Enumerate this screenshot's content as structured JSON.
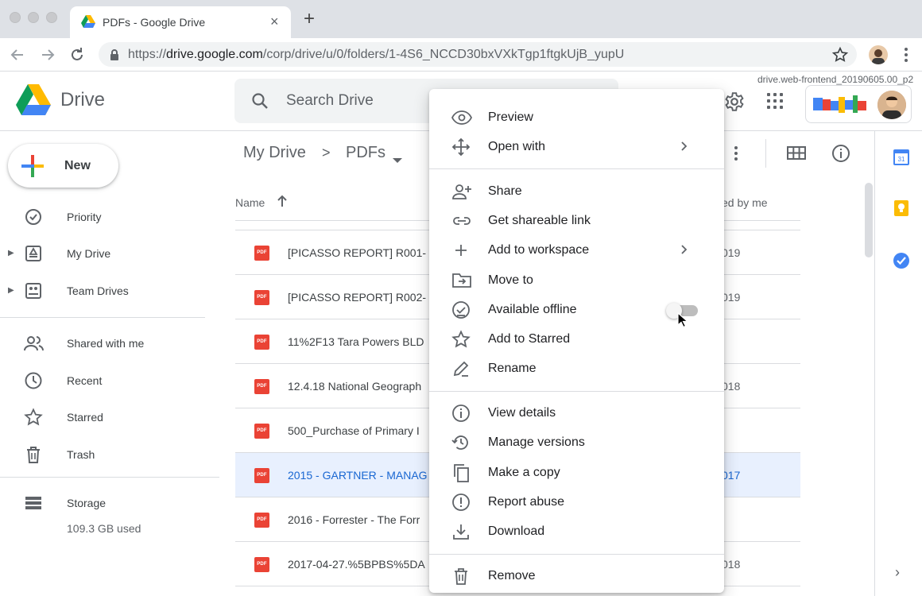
{
  "browser": {
    "tab_title": "PDFs - Google Drive",
    "tab_close": "×",
    "new_tab": "+",
    "url_prefix": "https://",
    "url_host": "drive.google.com",
    "url_path": "/corp/drive/u/0/folders/1-4S6_NCCD30bxVXkTgp1ftgkUjB_yupU"
  },
  "header": {
    "app_title": "Drive",
    "search_placeholder": "Search Drive",
    "version_label": "drive.web-frontend_20190605.00_p2"
  },
  "sidebar": {
    "new_label": "New",
    "items": [
      {
        "label": "Priority",
        "icon": "priority-icon"
      },
      {
        "label": "My Drive",
        "icon": "my-drive-icon"
      },
      {
        "label": "Team Drives",
        "icon": "team-drives-icon"
      },
      {
        "label": "Shared with me",
        "icon": "shared-with-me-icon"
      },
      {
        "label": "Recent",
        "icon": "clock-icon"
      },
      {
        "label": "Starred",
        "icon": "star-icon"
      },
      {
        "label": "Trash",
        "icon": "trash-icon"
      }
    ],
    "storage_label": "Storage",
    "storage_used": "109.3 GB used"
  },
  "main": {
    "breadcrumb_root": "My Drive",
    "breadcrumb_sep": ">",
    "breadcrumb_current": "PDFs",
    "col_name": "Name",
    "col_modified": "ed by me",
    "files": [
      {
        "name": "[PICASSO REPORT] R001-",
        "date": "019",
        "icon_text": "PDF"
      },
      {
        "name": "[PICASSO REPORT] R002-",
        "date": "019",
        "icon_text": "PDF"
      },
      {
        "name": "11%2F13 Tara Powers BLD",
        "date": "",
        "icon_text": "PDF"
      },
      {
        "name": "12.4.18 National Geograph",
        "date": "018",
        "icon_text": "PDF"
      },
      {
        "name": "500_Purchase of Primary I",
        "date": "",
        "icon_text": "PDF"
      },
      {
        "name": "2015 - GARTNER - MANAG",
        "date": "017",
        "icon_text": "PDF",
        "selected": true
      },
      {
        "name": "2016 - Forrester - The Forr",
        "date": "",
        "icon_text": "PDF"
      },
      {
        "name": "2017-04-27.%5BPBS%5DA",
        "date": "018",
        "icon_text": "PDF"
      }
    ]
  },
  "context_menu": {
    "items": [
      {
        "label": "Preview",
        "icon": "eye-icon"
      },
      {
        "label": "Open with",
        "icon": "move-arrows-icon",
        "submenu": true
      },
      {
        "label": "Share",
        "icon": "add-person-icon"
      },
      {
        "label": "Get shareable link",
        "icon": "link-icon"
      },
      {
        "label": "Add to workspace",
        "icon": "plus-icon",
        "submenu": true
      },
      {
        "label": "Move to",
        "icon": "move-to-folder-icon"
      },
      {
        "label": "Available offline",
        "icon": "offline-check-icon",
        "toggle": false
      },
      {
        "label": "Add to Starred",
        "icon": "star-outline-icon"
      },
      {
        "label": "Rename",
        "icon": "pencil-icon"
      },
      {
        "label": "View details",
        "icon": "info-icon"
      },
      {
        "label": "Manage versions",
        "icon": "history-icon"
      },
      {
        "label": "Make a copy",
        "icon": "copy-icon"
      },
      {
        "label": "Report abuse",
        "icon": "alert-icon"
      },
      {
        "label": "Download",
        "icon": "download-icon"
      },
      {
        "label": "Remove",
        "icon": "trash-icon"
      }
    ]
  },
  "colors": {
    "drive_blue": "#4285f4",
    "drive_green": "#0f9d58",
    "drive_yellow": "#f4b400",
    "drive_red": "#db4437",
    "selected_row_bg": "#e8f0fe",
    "selected_text": "#1967d2",
    "pdf_red": "#ea4335"
  }
}
